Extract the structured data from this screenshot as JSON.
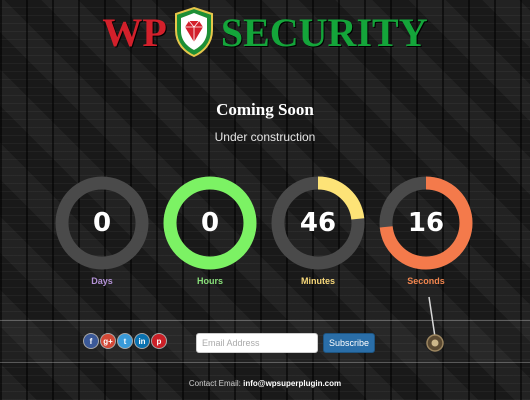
{
  "logo": {
    "part1": "WP",
    "part2": "SECURITY"
  },
  "heading": {
    "title": "Coming Soon",
    "subtitle": "Under construction"
  },
  "countdown": [
    {
      "value": "0",
      "label": "Days",
      "progress": 0.0,
      "color": "#4e4e4e",
      "label_color": "#b392d6"
    },
    {
      "value": "0",
      "label": "Hours",
      "progress": 1.0,
      "color": "#7cf264",
      "label_color": "#89e07a"
    },
    {
      "value": "46",
      "label": "Minutes",
      "progress": 0.233,
      "color": "#fde377",
      "label_color": "#f6d779"
    },
    {
      "value": "16",
      "label": "Seconds",
      "progress": 0.733,
      "color": "#f47a4b",
      "label_color": "#f2864f"
    }
  ],
  "social": [
    {
      "icon": "facebook-icon",
      "glyph": "f",
      "color": "#3b5998"
    },
    {
      "icon": "google-plus-icon",
      "glyph": "g+",
      "color": "#d34836"
    },
    {
      "icon": "twitter-icon",
      "glyph": "t",
      "color": "#3a9bd9"
    },
    {
      "icon": "linkedin-icon",
      "glyph": "in",
      "color": "#0a72b0"
    },
    {
      "icon": "pinterest-icon",
      "glyph": "p",
      "color": "#cb2027"
    }
  ],
  "subscribe": {
    "placeholder": "Email Address",
    "button_label": "Subscribe"
  },
  "footer": {
    "contact_label": "Contact Email:",
    "contact_email": "info@wpsuperplugin.com"
  },
  "colors": {
    "track": "#4a4a4a",
    "accent_button": "#2a6ea8",
    "logo_red": "#d3202b",
    "logo_green": "#14a53a"
  }
}
